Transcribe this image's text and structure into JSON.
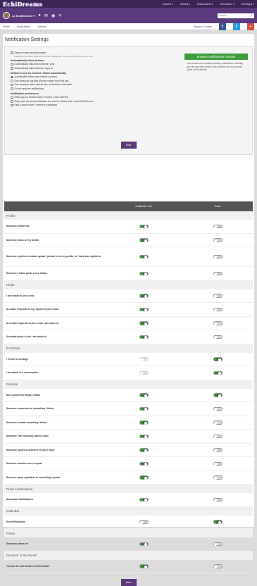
{
  "header": {
    "logo": "EchiDreams",
    "nav": [
      "Explore ▾",
      "Activity ▾",
      "Dashboards ▾",
      "Information ▾",
      "EchiApps ▾"
    ]
  },
  "user": {
    "name": "Ae EchiDreamer ▾",
    "search_placeholder": "Search..."
  },
  "subnav": {
    "items": [
      "Home",
      "Notifications",
      "Options"
    ],
    "general": "General Content"
  },
  "page": {
    "title": "Notification Settings"
  },
  "settings": {
    "send_news": "Send me news and information",
    "send_news_hint": "Disabling this option will add you to our mailing list. You can unsubscribe at any time.",
    "auto_follow_title": "Automatically follow dreams",
    "auto_follow": [
      "Automatically follow new dreams I post",
      "Automatically follow dreams I reply to"
    ],
    "method_title": "Method to see for content I follow automatically",
    "methods": [
      "A notification when new content is posted",
      "One email per day with all new content from that day",
      "One email per week with all new content from that week",
      "Do not send me notifications"
    ],
    "prefs_title": "Notification preferences",
    "prefs": [
      "Show pop-up window when I receive a new EchiText",
      "Only send one email notification for content I follow until I revisit EchiDreams",
      "Play a sound when I receive a notification"
    ],
    "browser_notice": "Browser notifications enabled",
    "browser_text": "Your browser has enabled desktop notifications, allowing us to let you when there's new content even if you aren't active in this window.",
    "save": "Save"
  },
  "table": {
    "col1": "Notification List",
    "col2": "Email",
    "groups": [
      {
        "name": "Profile",
        "rows": [
          {
            "label": "Someone follows me",
            "a": "on",
            "b": "off"
          },
          {
            "label": "Someone posts on my profile",
            "a": "on",
            "b": "off"
          },
          {
            "label": "Someone replies to a status update I posted, is on my profile, or I have also replied to",
            "a": "on",
            "b": "off"
          },
          {
            "label": "Someone I follow posts a new status.",
            "a": "on",
            "b": "off"
          }
        ]
      },
      {
        "name": "Clubs",
        "rows": [
          {
            "label": "I am invited to join a club",
            "a": "on",
            "b": "off"
          },
          {
            "label": "A Leader responds to my request to join a Club",
            "a": "on",
            "b": "off"
          },
          {
            "label": "A member requests to join a club I am leader of",
            "a": "on",
            "b": "off"
          },
          {
            "label": "A member joins a club I am leader of",
            "a": "on",
            "b": "off"
          }
        ]
      },
      {
        "name": "EchiTexts",
        "rows": [
          {
            "label": "I receive a message",
            "a": "dis",
            "b": "on"
          },
          {
            "label": "I am added to a conversation",
            "a": "dis",
            "b": "on"
          }
        ]
      },
      {
        "name": "General",
        "rows": [
          {
            "label": "New content for things I follow",
            "a": "on",
            "b": "on"
          },
          {
            "label": "Someone comments on something I follow",
            "a": "on",
            "b": "off"
          },
          {
            "label": "Someone reviews something I follow",
            "a": "on",
            "b": "off"
          },
          {
            "label": "Someone I am following makes a post",
            "a": "on",
            "b": "off"
          },
          {
            "label": "Someone quotes a comment or post I made",
            "a": "on",
            "b": "off"
          },
          {
            "label": "Someone mentions me in a post",
            "a": "on",
            "b": "off"
          },
          {
            "label": "Someone gives reputation to something I posted",
            "a": "on",
            "b": "off"
          }
        ]
      },
      {
        "name": "Rules Notifications",
        "rows": [
          {
            "label": "Automated Notifications",
            "a": "on",
            "b": "off"
          }
        ]
      },
      {
        "name": "Calendar",
        "rows": [
          {
            "label": "Event Reminders",
            "a": "off",
            "b": "on"
          }
        ]
      },
      {
        "name": "Pokes",
        "rows": [
          {
            "label": "Someone pokes me",
            "a": "on",
            "b": "off"
          }
        ]
      },
      {
        "name": "Dreamer of the Month",
        "rows": [
          {
            "label": "You are the new Dreamer of the Month!",
            "a": "on",
            "b": "off"
          }
        ]
      }
    ]
  },
  "colors": {
    "brand": "#3b2557",
    "accent": "#5a3a7c",
    "on": "#2f7d2f"
  }
}
